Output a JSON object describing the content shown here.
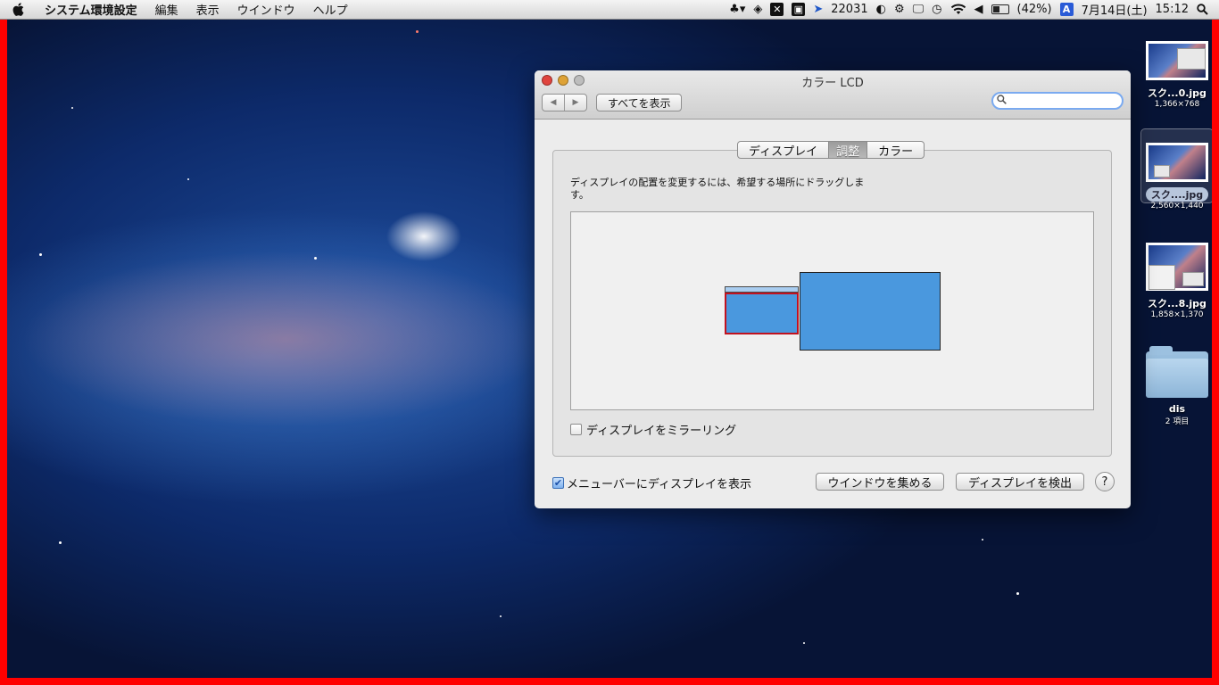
{
  "menubar": {
    "apple": "",
    "app_name": "システム環境設定",
    "menus": [
      "編集",
      "表示",
      "ウインドウ",
      "ヘルプ"
    ],
    "status": {
      "counter": "22031",
      "battery": "(42%)",
      "input_method": "A",
      "date": "7月14日(土)",
      "time": "15:12"
    }
  },
  "window": {
    "title": "カラー LCD",
    "back_arrow": "◀",
    "forward_arrow": "▶",
    "show_all": "すべてを表示",
    "search_placeholder": "",
    "tabs": [
      "ディスプレイ",
      "調整",
      "カラー"
    ],
    "selected_tab": "調整",
    "instruction": "ディスプレイの配置を変更するには、希望する場所にドラッグします。",
    "mirror_label": "ディスプレイをミラーリング",
    "mirror_checked": false,
    "show_in_menubar_label": "メニューバーにディスプレイを表示",
    "show_in_menubar_checked": true,
    "gather_windows": "ウインドウを集める",
    "detect_displays": "ディスプレイを検出",
    "help": "?"
  },
  "desktop_items": [
    {
      "name": "スク...0.jpg",
      "meta": "1,366×768"
    },
    {
      "name": "スク....jpg",
      "meta": "2,560×1,440",
      "selected": true
    },
    {
      "name": "スク...8.jpg",
      "meta": "1,858×1,370"
    },
    {
      "name": "dis",
      "meta": "2 項目"
    }
  ],
  "colors": {
    "display_blue": "#4a98de",
    "selection_red": "#c1121f",
    "frame_red": "#ff0000"
  }
}
